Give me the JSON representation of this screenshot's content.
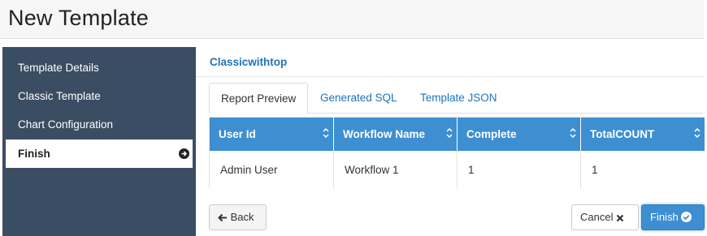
{
  "page": {
    "title": "New Template"
  },
  "sidebar": {
    "items": [
      {
        "label": "Template Details",
        "active": false
      },
      {
        "label": "Classic Template",
        "active": false
      },
      {
        "label": "Chart Configuration",
        "active": false
      },
      {
        "label": "Finish",
        "active": true,
        "icon": "arrow-circle-right-icon"
      }
    ]
  },
  "content": {
    "template_name": "Classicwithtop",
    "tabs": [
      {
        "label": "Report Preview",
        "active": true
      },
      {
        "label": "Generated SQL",
        "active": false
      },
      {
        "label": "Template JSON",
        "active": false
      }
    ],
    "grid": {
      "columns": [
        "User Id",
        "Workflow Name",
        "Complete",
        "TotalCOUNT"
      ],
      "rows": [
        [
          "Admin User",
          "Workflow 1",
          "1",
          "1"
        ]
      ],
      "header_color": "#3d8fd1"
    }
  },
  "footer": {
    "back_label": "Back",
    "cancel_label": "Cancel",
    "finish_label": "Finish"
  },
  "colors": {
    "sidebar_bg": "#3b4d63",
    "accent": "#3d8fd1",
    "link": "#1f73b7"
  }
}
